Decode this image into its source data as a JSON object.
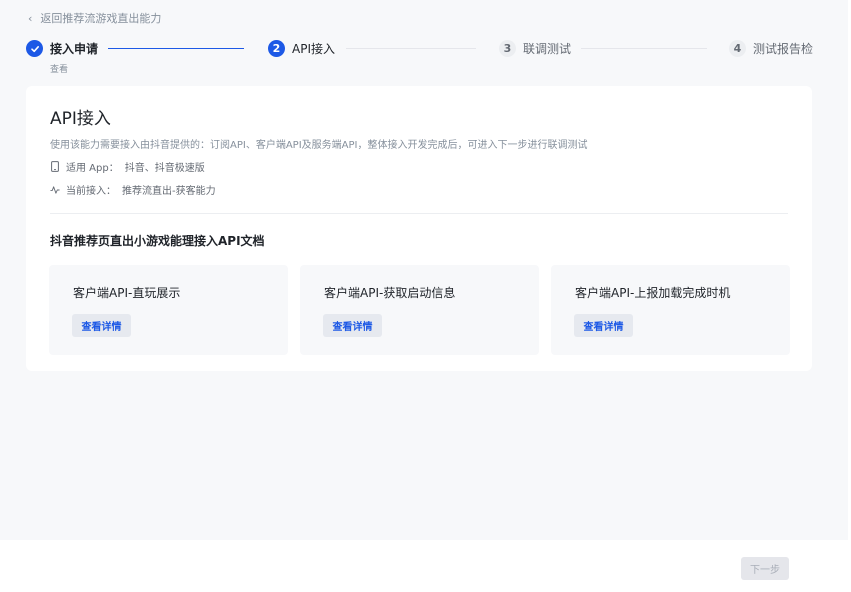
{
  "back": {
    "label": "返回推荐流游戏直出能力"
  },
  "steps": [
    {
      "number": "",
      "label": "接入申请",
      "sub": "查看",
      "status": "done"
    },
    {
      "number": "2",
      "label": "API接入",
      "status": "active"
    },
    {
      "number": "3",
      "label": "联调测试",
      "status": "todo"
    },
    {
      "number": "4",
      "label": "测试报告检",
      "status": "todo"
    }
  ],
  "card": {
    "title": "API接入",
    "description": "使用该能力需要接入由抖音提供的：订阅API、客户端API及服务端API，整体接入开发完成后，可进入下一步进行联调测试",
    "app_label": "适用 App：",
    "app_value": "抖音、抖音极速版",
    "current_label": "当前接入：",
    "current_value": "推荐流直出-获客能力",
    "section_title": "抖音推荐页直出小游戏能理接入API文档",
    "docs": [
      {
        "title": "客户端API-直玩展示",
        "button": "查看详情"
      },
      {
        "title": "客户端API-获取启动信息",
        "button": "查看详情"
      },
      {
        "title": "客户端API-上报加载完成时机",
        "button": "查看详情"
      }
    ]
  },
  "footer": {
    "next_label": "下一步"
  },
  "colors": {
    "accent": "#1d59e6",
    "page_bg": "#f7f8fa"
  }
}
